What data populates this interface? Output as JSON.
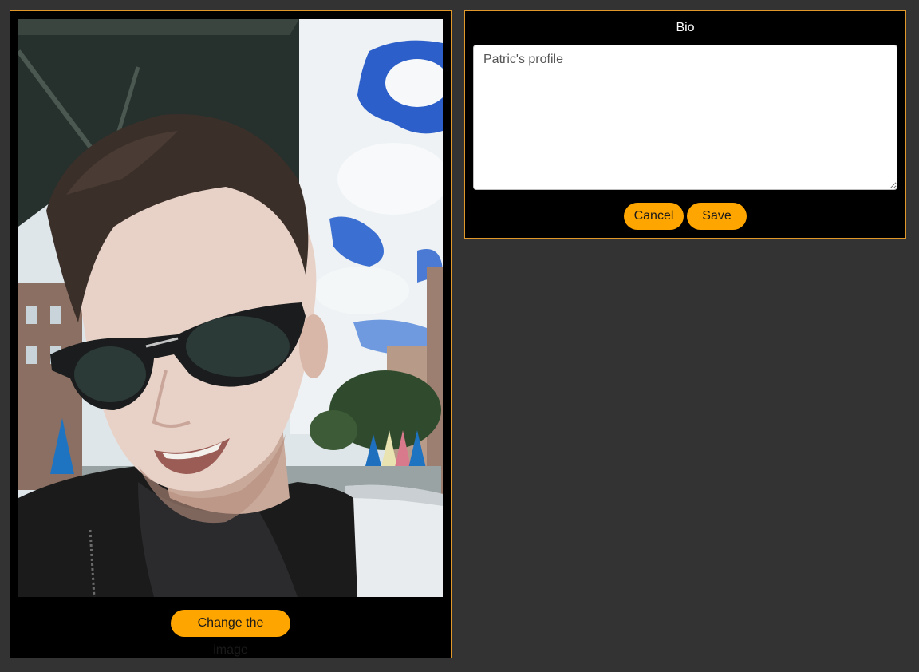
{
  "profile_image": {
    "alt": "",
    "change_button_label": "Change the image"
  },
  "bio": {
    "title": "Bio",
    "placeholder": "Patric's profile",
    "value": "",
    "cancel_label": "Cancel",
    "save_label": "Save"
  },
  "colors": {
    "page_background": "#333333",
    "panel_background": "#000000",
    "panel_border": "#e0982a",
    "button_background": "#ffa500",
    "button_text": "#1a1a1a"
  }
}
